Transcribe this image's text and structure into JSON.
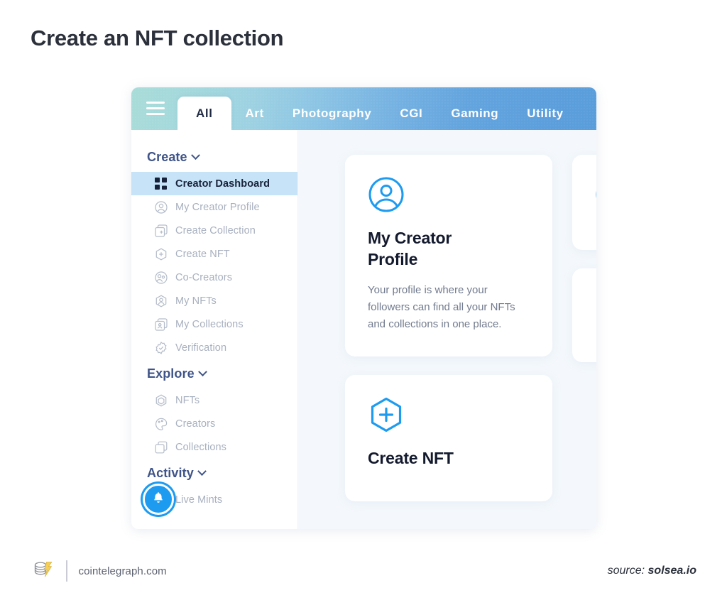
{
  "page": {
    "title": "Create an NFT collection"
  },
  "browser": {
    "topnav": {
      "menu_icon": "hamburger-menu-icon",
      "tabs": [
        {
          "label": "All",
          "active": true
        },
        {
          "label": "Art",
          "active": false
        },
        {
          "label": "Photography",
          "active": false
        },
        {
          "label": "CGI",
          "active": false
        },
        {
          "label": "Gaming",
          "active": false
        },
        {
          "label": "Utility",
          "active": false
        }
      ]
    },
    "sidebar": {
      "sections": [
        {
          "label": "Create",
          "expanded": true,
          "items": [
            {
              "label": "Creator Dashboard",
              "icon": "grid-dashboard-icon",
              "active": true
            },
            {
              "label": "My Creator Profile",
              "icon": "user-circle-icon",
              "active": false
            },
            {
              "label": "Create Collection",
              "icon": "layered-squares-plus-icon",
              "active": false
            },
            {
              "label": "Create NFT",
              "icon": "hexagon-plus-icon",
              "active": false
            },
            {
              "label": "Co-Creators",
              "icon": "users-group-icon",
              "active": false
            },
            {
              "label": "My NFTs",
              "icon": "hexagon-user-icon",
              "active": false
            },
            {
              "label": "My Collections",
              "icon": "layered-squares-user-icon",
              "active": false
            },
            {
              "label": "Verification",
              "icon": "badge-check-icon",
              "active": false
            }
          ]
        },
        {
          "label": "Explore",
          "expanded": true,
          "items": [
            {
              "label": "NFTs",
              "icon": "hexagon-outline-icon",
              "active": false
            },
            {
              "label": "Creators",
              "icon": "creator-palette-icon",
              "active": false
            },
            {
              "label": "Collections",
              "icon": "stacked-squares-icon",
              "active": false
            }
          ]
        },
        {
          "label": "Activity",
          "expanded": true,
          "items": [
            {
              "label": "Live Mints",
              "icon": "live-mints-icon",
              "active": false
            }
          ]
        }
      ],
      "notification_badge": {
        "icon": "bell-icon",
        "color": "#1d9bf0"
      }
    },
    "content": {
      "cards": [
        {
          "icon": "user-circle-icon",
          "title": "My Creator Profile",
          "description": "Your profile is where your followers can find all your NFTs and collections in one place."
        },
        {
          "icon": "hexagon-plus-icon",
          "title": "Create NFT",
          "description": ""
        }
      ]
    }
  },
  "footer": {
    "logo_icon": "cointelegraph-logo-icon",
    "site": "cointelegraph.com",
    "source_prefix": "source:",
    "source_name": "solsea.io"
  },
  "colors": {
    "accent_blue": "#1d9bf0",
    "nav_gradient_start": "#a9dcd8",
    "nav_gradient_end": "#5a9ddb",
    "active_item_bg": "#c6e3f7",
    "heading": "#2b303b",
    "section_head": "#3f5488"
  }
}
